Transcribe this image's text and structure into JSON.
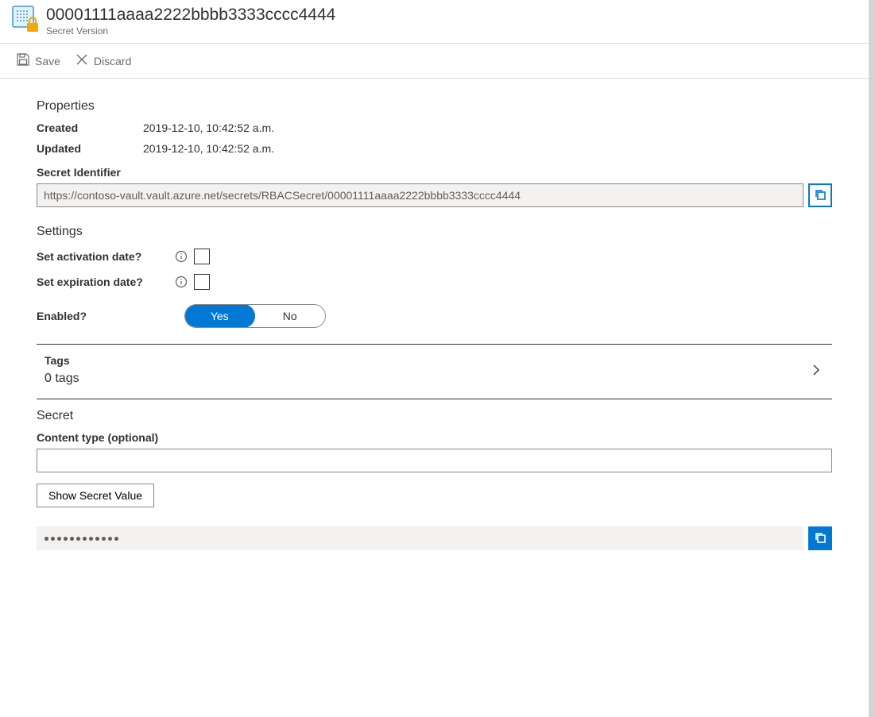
{
  "header": {
    "title": "00001111aaaa2222bbbb3333cccc4444",
    "subtitle": "Secret Version"
  },
  "toolbar": {
    "save_label": "Save",
    "discard_label": "Discard"
  },
  "properties": {
    "section_title": "Properties",
    "created_label": "Created",
    "created_value": "2019-12-10, 10:42:52 a.m.",
    "updated_label": "Updated",
    "updated_value": "2019-12-10, 10:42:52 a.m.",
    "identifier_label": "Secret Identifier",
    "identifier_value": "https://contoso-vault.vault.azure.net/secrets/RBACSecret/00001111aaaa2222bbbb3333cccc4444"
  },
  "settings": {
    "section_title": "Settings",
    "activation_label": "Set activation date?",
    "expiration_label": "Set expiration date?",
    "enabled_label": "Enabled?",
    "enabled_yes": "Yes",
    "enabled_no": "No",
    "enabled_value": "Yes"
  },
  "tags": {
    "title": "Tags",
    "count_text": "0 tags"
  },
  "secret": {
    "section_title": "Secret",
    "content_type_label": "Content type (optional)",
    "content_type_value": "",
    "show_button": "Show Secret Value",
    "masked_value": "••••••••••••"
  }
}
